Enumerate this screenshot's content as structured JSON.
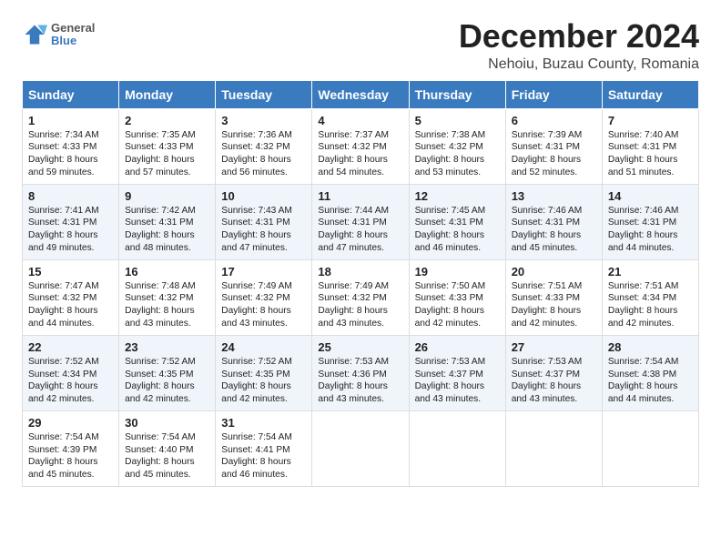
{
  "header": {
    "logo_line1": "General",
    "logo_line2": "Blue",
    "title": "December 2024",
    "subtitle": "Nehoiu, Buzau County, Romania"
  },
  "weekdays": [
    "Sunday",
    "Monday",
    "Tuesday",
    "Wednesday",
    "Thursday",
    "Friday",
    "Saturday"
  ],
  "weeks": [
    [
      {
        "day": "1",
        "lines": [
          "Sunrise: 7:34 AM",
          "Sunset: 4:33 PM",
          "Daylight: 8 hours",
          "and 59 minutes."
        ]
      },
      {
        "day": "2",
        "lines": [
          "Sunrise: 7:35 AM",
          "Sunset: 4:33 PM",
          "Daylight: 8 hours",
          "and 57 minutes."
        ]
      },
      {
        "day": "3",
        "lines": [
          "Sunrise: 7:36 AM",
          "Sunset: 4:32 PM",
          "Daylight: 8 hours",
          "and 56 minutes."
        ]
      },
      {
        "day": "4",
        "lines": [
          "Sunrise: 7:37 AM",
          "Sunset: 4:32 PM",
          "Daylight: 8 hours",
          "and 54 minutes."
        ]
      },
      {
        "day": "5",
        "lines": [
          "Sunrise: 7:38 AM",
          "Sunset: 4:32 PM",
          "Daylight: 8 hours",
          "and 53 minutes."
        ]
      },
      {
        "day": "6",
        "lines": [
          "Sunrise: 7:39 AM",
          "Sunset: 4:31 PM",
          "Daylight: 8 hours",
          "and 52 minutes."
        ]
      },
      {
        "day": "7",
        "lines": [
          "Sunrise: 7:40 AM",
          "Sunset: 4:31 PM",
          "Daylight: 8 hours",
          "and 51 minutes."
        ]
      }
    ],
    [
      {
        "day": "8",
        "lines": [
          "Sunrise: 7:41 AM",
          "Sunset: 4:31 PM",
          "Daylight: 8 hours",
          "and 49 minutes."
        ]
      },
      {
        "day": "9",
        "lines": [
          "Sunrise: 7:42 AM",
          "Sunset: 4:31 PM",
          "Daylight: 8 hours",
          "and 48 minutes."
        ]
      },
      {
        "day": "10",
        "lines": [
          "Sunrise: 7:43 AM",
          "Sunset: 4:31 PM",
          "Daylight: 8 hours",
          "and 47 minutes."
        ]
      },
      {
        "day": "11",
        "lines": [
          "Sunrise: 7:44 AM",
          "Sunset: 4:31 PM",
          "Daylight: 8 hours",
          "and 47 minutes."
        ]
      },
      {
        "day": "12",
        "lines": [
          "Sunrise: 7:45 AM",
          "Sunset: 4:31 PM",
          "Daylight: 8 hours",
          "and 46 minutes."
        ]
      },
      {
        "day": "13",
        "lines": [
          "Sunrise: 7:46 AM",
          "Sunset: 4:31 PM",
          "Daylight: 8 hours",
          "and 45 minutes."
        ]
      },
      {
        "day": "14",
        "lines": [
          "Sunrise: 7:46 AM",
          "Sunset: 4:31 PM",
          "Daylight: 8 hours",
          "and 44 minutes."
        ]
      }
    ],
    [
      {
        "day": "15",
        "lines": [
          "Sunrise: 7:47 AM",
          "Sunset: 4:32 PM",
          "Daylight: 8 hours",
          "and 44 minutes."
        ]
      },
      {
        "day": "16",
        "lines": [
          "Sunrise: 7:48 AM",
          "Sunset: 4:32 PM",
          "Daylight: 8 hours",
          "and 43 minutes."
        ]
      },
      {
        "day": "17",
        "lines": [
          "Sunrise: 7:49 AM",
          "Sunset: 4:32 PM",
          "Daylight: 8 hours",
          "and 43 minutes."
        ]
      },
      {
        "day": "18",
        "lines": [
          "Sunrise: 7:49 AM",
          "Sunset: 4:32 PM",
          "Daylight: 8 hours",
          "and 43 minutes."
        ]
      },
      {
        "day": "19",
        "lines": [
          "Sunrise: 7:50 AM",
          "Sunset: 4:33 PM",
          "Daylight: 8 hours",
          "and 42 minutes."
        ]
      },
      {
        "day": "20",
        "lines": [
          "Sunrise: 7:51 AM",
          "Sunset: 4:33 PM",
          "Daylight: 8 hours",
          "and 42 minutes."
        ]
      },
      {
        "day": "21",
        "lines": [
          "Sunrise: 7:51 AM",
          "Sunset: 4:34 PM",
          "Daylight: 8 hours",
          "and 42 minutes."
        ]
      }
    ],
    [
      {
        "day": "22",
        "lines": [
          "Sunrise: 7:52 AM",
          "Sunset: 4:34 PM",
          "Daylight: 8 hours",
          "and 42 minutes."
        ]
      },
      {
        "day": "23",
        "lines": [
          "Sunrise: 7:52 AM",
          "Sunset: 4:35 PM",
          "Daylight: 8 hours",
          "and 42 minutes."
        ]
      },
      {
        "day": "24",
        "lines": [
          "Sunrise: 7:52 AM",
          "Sunset: 4:35 PM",
          "Daylight: 8 hours",
          "and 42 minutes."
        ]
      },
      {
        "day": "25",
        "lines": [
          "Sunrise: 7:53 AM",
          "Sunset: 4:36 PM",
          "Daylight: 8 hours",
          "and 43 minutes."
        ]
      },
      {
        "day": "26",
        "lines": [
          "Sunrise: 7:53 AM",
          "Sunset: 4:37 PM",
          "Daylight: 8 hours",
          "and 43 minutes."
        ]
      },
      {
        "day": "27",
        "lines": [
          "Sunrise: 7:53 AM",
          "Sunset: 4:37 PM",
          "Daylight: 8 hours",
          "and 43 minutes."
        ]
      },
      {
        "day": "28",
        "lines": [
          "Sunrise: 7:54 AM",
          "Sunset: 4:38 PM",
          "Daylight: 8 hours",
          "and 44 minutes."
        ]
      }
    ],
    [
      {
        "day": "29",
        "lines": [
          "Sunrise: 7:54 AM",
          "Sunset: 4:39 PM",
          "Daylight: 8 hours",
          "and 45 minutes."
        ]
      },
      {
        "day": "30",
        "lines": [
          "Sunrise: 7:54 AM",
          "Sunset: 4:40 PM",
          "Daylight: 8 hours",
          "and 45 minutes."
        ]
      },
      {
        "day": "31",
        "lines": [
          "Sunrise: 7:54 AM",
          "Sunset: 4:41 PM",
          "Daylight: 8 hours",
          "and 46 minutes."
        ]
      },
      null,
      null,
      null,
      null
    ]
  ]
}
